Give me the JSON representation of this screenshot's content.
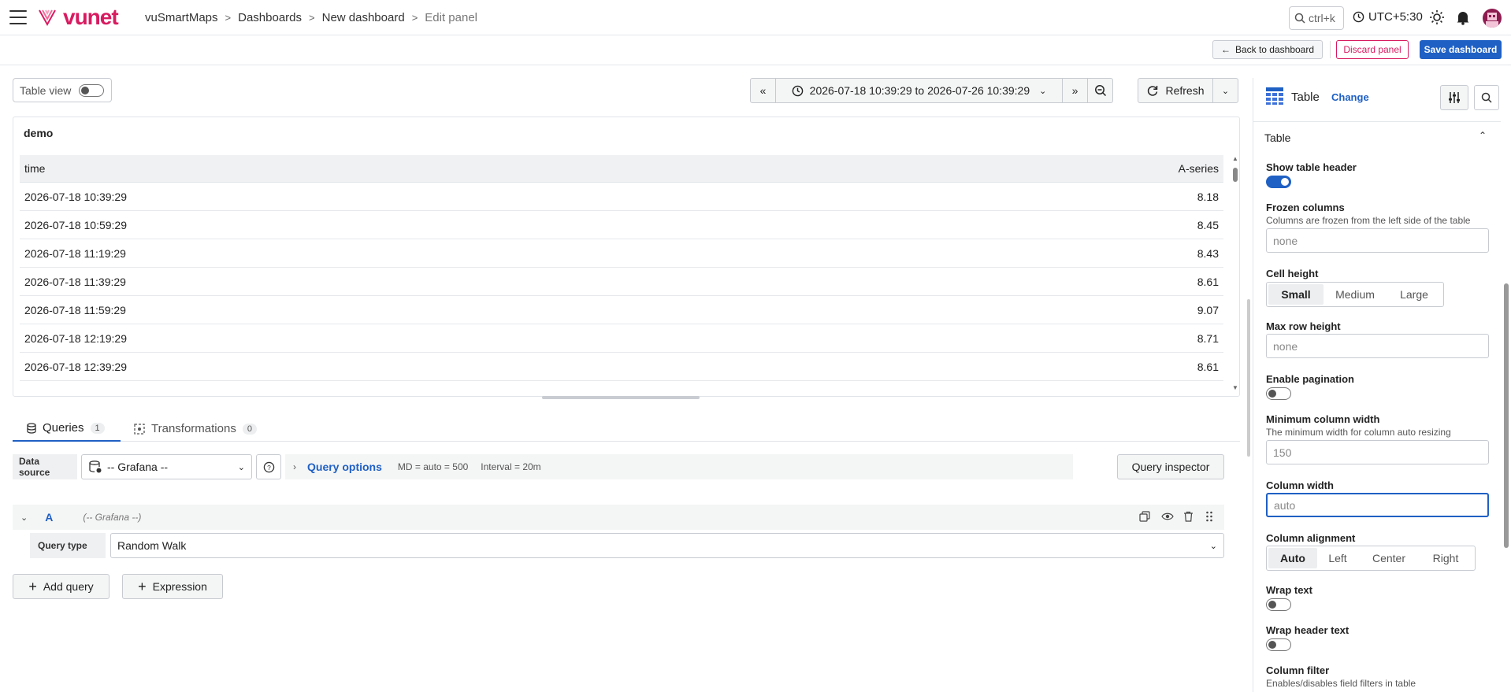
{
  "brand": {
    "logo_text": "vunet",
    "color": "#d81b60"
  },
  "breadcrumb": [
    "vuSmartMaps",
    "Dashboards",
    "New dashboard",
    "Edit panel"
  ],
  "topbar": {
    "search_placeholder": "ctrl+k",
    "timezone": "UTC+5:30"
  },
  "actions": {
    "back": "Back to dashboard",
    "discard": "Discard panel",
    "save": "Save dashboard"
  },
  "toolbar": {
    "table_view_label": "Table view",
    "table_view_on": false,
    "time_range": "2026-07-18 10:39:29 to 2026-07-26 10:39:29",
    "refresh_label": "Refresh"
  },
  "panel": {
    "title": "demo",
    "columns": [
      "time",
      "A-series"
    ],
    "rows": [
      [
        "2026-07-18 10:39:29",
        "8.18"
      ],
      [
        "2026-07-18 10:59:29",
        "8.45"
      ],
      [
        "2026-07-18 11:19:29",
        "8.43"
      ],
      [
        "2026-07-18 11:39:29",
        "8.61"
      ],
      [
        "2026-07-18 11:59:29",
        "9.07"
      ],
      [
        "2026-07-18 12:19:29",
        "8.71"
      ],
      [
        "2026-07-18 12:39:29",
        "8.61"
      ]
    ]
  },
  "tabs": [
    {
      "label": "Queries",
      "count": "1",
      "active": true
    },
    {
      "label": "Transformations",
      "count": "0",
      "active": false
    }
  ],
  "query": {
    "data_source_label": "Data source",
    "data_source": "-- Grafana --",
    "query_options_label": "Query options",
    "md": "MD = auto = 500",
    "interval": "Interval = 20m",
    "inspector": "Query inspector",
    "ref_id": "A",
    "ref_source": "(-- Grafana --)",
    "query_type_label": "Query type",
    "query_type": "Random Walk",
    "add_query": "Add query",
    "expression": "Expression"
  },
  "options_pane": {
    "viz_name": "Table",
    "change_label": "Change",
    "section_title": "Table",
    "show_header": {
      "label": "Show table header",
      "on": true
    },
    "frozen": {
      "label": "Frozen columns",
      "desc": "Columns are frozen from the left side of the table",
      "placeholder": "none"
    },
    "cell_height": {
      "label": "Cell height",
      "options": [
        "Small",
        "Medium",
        "Large"
      ],
      "selected": "Small"
    },
    "max_row_height": {
      "label": "Max row height",
      "placeholder": "none"
    },
    "pagination": {
      "label": "Enable pagination",
      "on": false
    },
    "min_col_width": {
      "label": "Minimum column width",
      "desc": "The minimum width for column auto resizing",
      "placeholder": "150"
    },
    "col_width": {
      "label": "Column width",
      "placeholder": "auto"
    },
    "col_align": {
      "label": "Column alignment",
      "options": [
        "Auto",
        "Left",
        "Center",
        "Right"
      ],
      "selected": "Auto"
    },
    "wrap_text": {
      "label": "Wrap text",
      "on": false
    },
    "wrap_header": {
      "label": "Wrap header text",
      "on": false
    },
    "col_filter": {
      "label": "Column filter",
      "desc": "Enables/disables field filters in table"
    }
  },
  "colors": {
    "primary": "#1f60c4",
    "accent": "#d81b60"
  }
}
